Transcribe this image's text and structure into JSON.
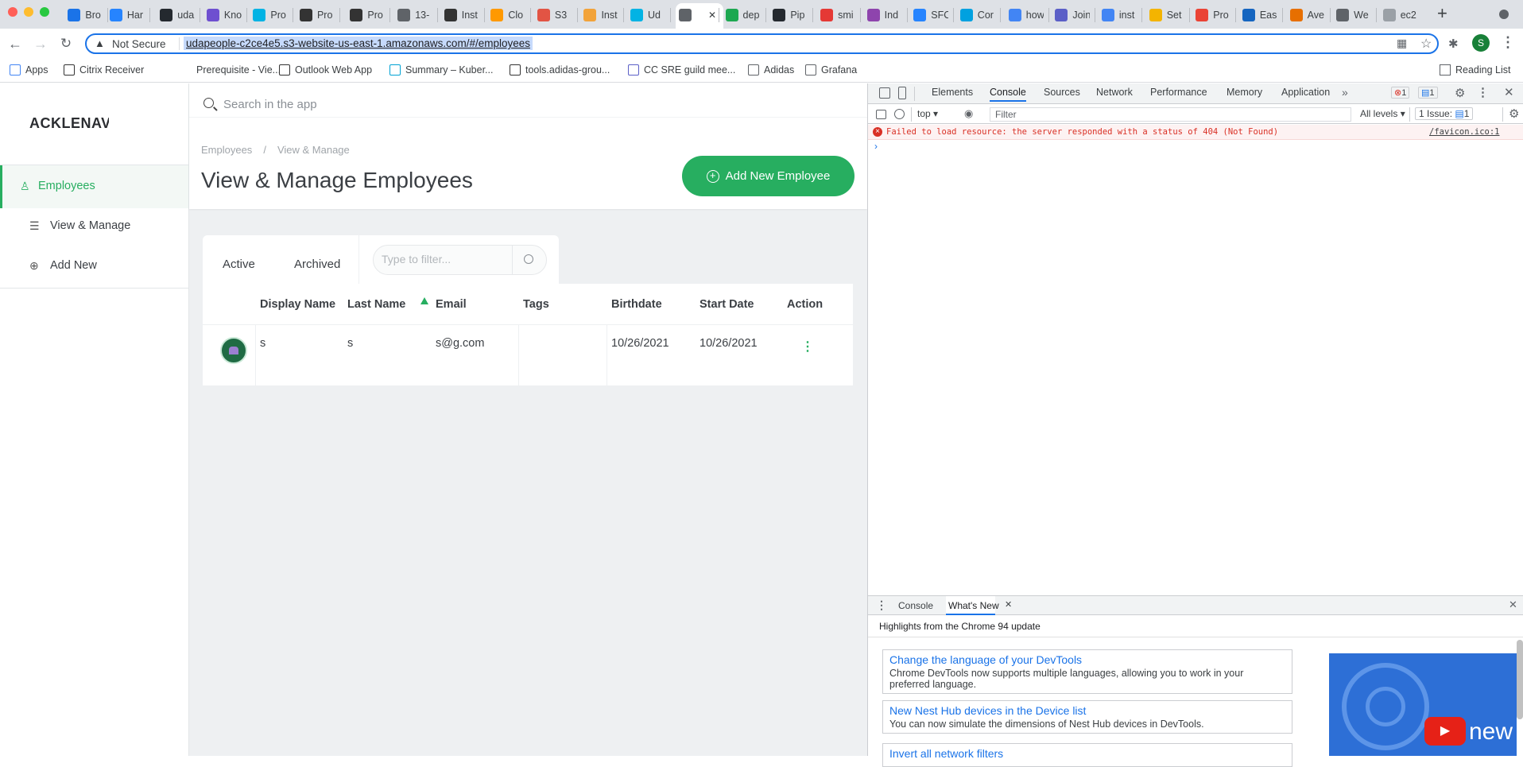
{
  "browser": {
    "tabs": [
      {
        "label": "Bro",
        "color": "#1a73e8"
      },
      {
        "label": "Har",
        "color": "#2684ff"
      },
      {
        "label": "uda",
        "color": "#24292f"
      },
      {
        "label": "Kno",
        "color": "#6e4fd0"
      },
      {
        "label": "Pro",
        "color": "#02b3e4"
      },
      {
        "label": "Pro",
        "color": "#333333"
      },
      {
        "label": "Pro",
        "color": "#333333"
      },
      {
        "label": "13-",
        "color": "#5f6368"
      },
      {
        "label": "Inst",
        "color": "#333333"
      },
      {
        "label": "Clo",
        "color": "#ff9900"
      },
      {
        "label": "S3",
        "color": "#e25444"
      },
      {
        "label": "Inst",
        "color": "#f2a33a"
      },
      {
        "label": "Ud",
        "color": "#02b3e4"
      },
      {
        "label": "",
        "color": "#5f6368"
      },
      {
        "label": "dep",
        "color": "#1da851"
      },
      {
        "label": "Pip",
        "color": "#24292f"
      },
      {
        "label": "smi",
        "color": "#e53935"
      },
      {
        "label": "Ind",
        "color": "#8e44ad"
      },
      {
        "label": "SFC",
        "color": "#2684ff"
      },
      {
        "label": "Cor",
        "color": "#00a1e0"
      },
      {
        "label": "how",
        "color": "#4285f4"
      },
      {
        "label": "Join",
        "color": "#5b5fc7"
      },
      {
        "label": "inst",
        "color": "#4285f4"
      },
      {
        "label": "Set",
        "color": "#f4b400"
      },
      {
        "label": "Pro",
        "color": "#ea4335"
      },
      {
        "label": "Eas",
        "color": "#1565c0"
      },
      {
        "label": "Ave",
        "color": "#e76f00"
      },
      {
        "label": "We",
        "color": "#5f6368"
      },
      {
        "label": "ec2",
        "color": "#9aa0a6"
      }
    ],
    "new_tab_icon": "plus-icon",
    "profile_initial": "S",
    "security_label": "Not Secure",
    "url": "udapeople-c2ce4e5.s3-website-us-east-1.amazonaws.com/#/employees",
    "bookmarks": [
      "Apps",
      "Citrix Receiver",
      "Prerequisite - Vie...",
      "Outlook Web App",
      "Summary – Kuber...",
      "tools.adidas-grou...",
      "CC SRE guild mee...",
      "Adidas",
      "Grafana"
    ],
    "reading_list": "Reading List"
  },
  "app": {
    "logo": "ACKLENAV",
    "search_placeholder": "Search in the app",
    "sidebar": {
      "items": [
        {
          "label": "Employees",
          "icon": "user-icon"
        },
        {
          "label": "View & Manage",
          "icon": "list-icon"
        },
        {
          "label": "Add New",
          "icon": "plus-circle-icon"
        }
      ]
    },
    "breadcrumb": [
      "Employees",
      "/",
      "View & Manage"
    ],
    "page_title": "View & Manage Employees",
    "add_button": "Add New Employee",
    "tabs": [
      "Active",
      "Archived"
    ],
    "filter_placeholder": "Type to filter...",
    "table": {
      "headers": [
        "Display Name",
        "Last Name",
        "Email",
        "Tags",
        "Birthdate",
        "Start Date",
        "Action"
      ],
      "rows": [
        {
          "display_name": "s",
          "last_name": "s",
          "email": "s@g.com",
          "tags": "",
          "birthdate": "10/26/2021",
          "start_date": "10/26/2021"
        }
      ]
    },
    "accent": "#27ae60"
  },
  "devtools": {
    "tabs": [
      "Elements",
      "Console",
      "Sources",
      "Network",
      "Performance",
      "Memory",
      "Application"
    ],
    "error_count": "1",
    "message_count": "1",
    "context": "top",
    "filter_placeholder": "Filter",
    "levels": "All levels",
    "issues": "1 Issue:",
    "issues_count": "1",
    "error_message": "Failed to load resource: the server responded with a status of 404 (Not Found)",
    "error_source": "/favicon.ico:1",
    "drawer_tabs": [
      "Console",
      "What's New"
    ],
    "whatsnew_header": "Highlights from the Chrome 94 update",
    "cards": [
      {
        "title": "Change the language of your DevTools",
        "desc": "Chrome DevTools now supports multiple languages, allowing you to work in your preferred language."
      },
      {
        "title": "New Nest Hub devices in the Device list",
        "desc": "You can now simulate the dimensions of Nest Hub devices in DevTools."
      },
      {
        "title": "Invert all network filters",
        "desc": ""
      }
    ],
    "video_label": "new"
  }
}
